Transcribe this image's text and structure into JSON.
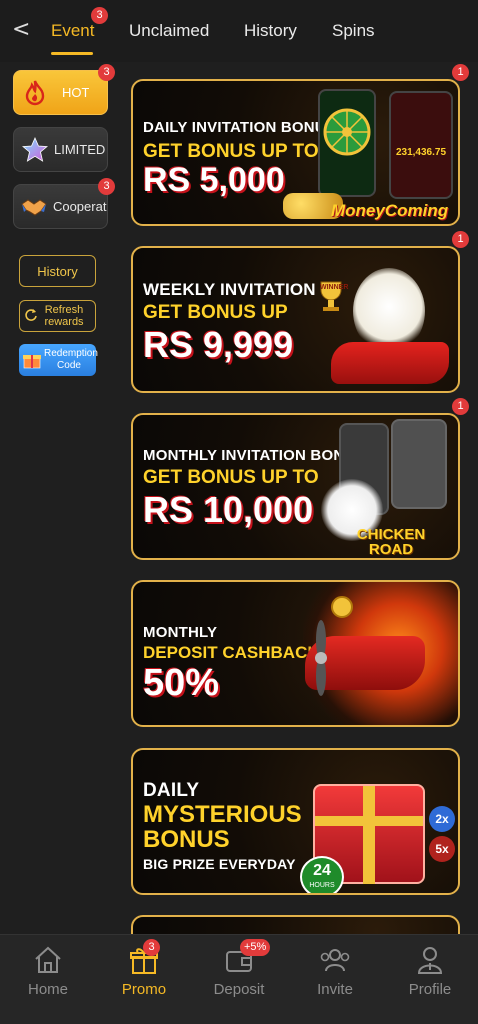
{
  "top_tabs": {
    "back": "<",
    "items": [
      {
        "label": "Event",
        "active": true,
        "badge": "3"
      },
      {
        "label": "Unclaimed"
      },
      {
        "label": "History"
      },
      {
        "label": "Spins"
      }
    ]
  },
  "sidebar": {
    "categories": [
      {
        "label": "HOT",
        "icon": "flame-icon",
        "badge": "3",
        "active": true
      },
      {
        "label": "LIMITED",
        "icon": "star-icon"
      },
      {
        "label": "Cooperation",
        "icon": "handshake-icon",
        "badge": "3"
      }
    ],
    "history_label": "History",
    "refresh_label": "Refresh rewards",
    "redemption_label": "Redemption Code"
  },
  "banners": [
    {
      "line1": "DAILY INVITATION BONUS",
      "line2": "GET BONUS UP TO",
      "line3": "RS 5,000",
      "badge": "1",
      "game": "MoneyComing",
      "jackpot": "231,436.75"
    },
    {
      "line1": "WEEKLY INVITATION",
      "line2": "GET BONUS UP",
      "line3": "RS 9,999",
      "badge": "1",
      "trophy": "WINNER"
    },
    {
      "line1": "MONTHLY INVITATION BONUS",
      "line2": "GET BONUS UP TO",
      "line3": "RS 10,000",
      "badge": "1",
      "game": "CHICKEN ROAD"
    },
    {
      "line1": "MONTHLY",
      "line2": "DEPOSIT CASHBACK",
      "line3": "50%"
    },
    {
      "line1": "DAILY",
      "line2": "MYSTERIOUS BONUS",
      "line3": "BIG PRIZE EVERYDAY",
      "hours": "24",
      "hours_label": "HOURS",
      "multipliers": [
        "2x",
        "5x"
      ]
    }
  ],
  "bottom_nav": [
    {
      "label": "Home",
      "icon": "home-icon"
    },
    {
      "label": "Promo",
      "icon": "gift-icon",
      "active": true,
      "badge": "3"
    },
    {
      "label": "Deposit",
      "icon": "wallet-icon",
      "badge": "+5%"
    },
    {
      "label": "Invite",
      "icon": "invite-icon"
    },
    {
      "label": "Profile",
      "icon": "profile-icon"
    }
  ],
  "colors": {
    "accent": "#f5b925",
    "badge": "#e23b3b",
    "banner_border": "#e2b14a",
    "background": "#1f1f1f"
  }
}
